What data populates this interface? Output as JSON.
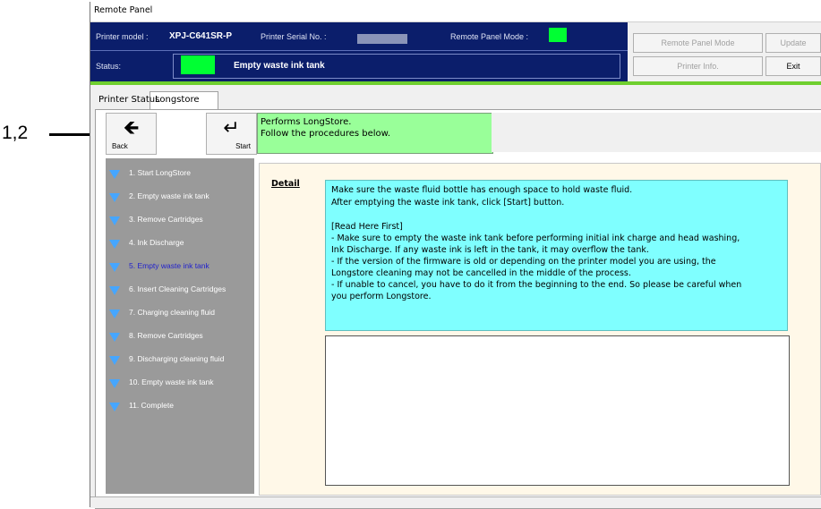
{
  "callout": {
    "label": "1,2"
  },
  "window": {
    "title": "Remote Panel"
  },
  "header": {
    "printer_model_label": "Printer model :",
    "printer_model_value": "XPJ-C641SR-P",
    "serial_label": "Printer Serial No. :",
    "remote_mode_label": "Remote Panel Mode :",
    "status_label": "Status:",
    "status_value": "Empty waste ink tank",
    "indicator_color": "#00ff33"
  },
  "side_buttons": {
    "remote_panel_mode": "Remote Panel Mode",
    "update": "Update",
    "printer_info": "Printer Info.",
    "exit": "Exit"
  },
  "tabs": [
    {
      "label": "Printer Status",
      "active": false
    },
    {
      "label": "Longstore",
      "active": true
    }
  ],
  "toolbar": {
    "back_label": "Back",
    "start_label": "Start",
    "back_icon": "arrow-left-icon",
    "start_icon": "return-arrow-icon"
  },
  "message": {
    "line1": "Performs LongStore.",
    "line2": "Follow the procedures below."
  },
  "steps": [
    {
      "label": "1. Start LongStore"
    },
    {
      "label": "2. Empty waste ink tank"
    },
    {
      "label": "3. Remove Cartridges"
    },
    {
      "label": "4. Ink Discharge"
    },
    {
      "label": "5. Empty waste ink tank",
      "current": true
    },
    {
      "label": "6. Insert Cleaning Cartridges"
    },
    {
      "label": "7. Charging cleaning fluid"
    },
    {
      "label": "8. Remove Cartridges"
    },
    {
      "label": "9. Discharging cleaning fluid"
    },
    {
      "label": "10. Empty waste ink tank"
    },
    {
      "label": "11. Complete"
    }
  ],
  "detail": {
    "label": "Detail",
    "lines": [
      "Make sure the waste fluid bottle has enough space to hold waste fluid.",
      "After emptying the waste ink tank, click [Start] button.",
      "",
      "[Read Here First]",
      "- Make sure to empty the waste ink tank before performing initial ink charge and head washing,",
      "Ink Discharge. If any waste ink is left in the tank, it may overflow the tank.",
      " - If the version of the firmware is old or depending on the printer model you are using, the",
      "Longstore cleaning may not be cancelled in the middle of the process.",
      " - If unable to cancel, you have to do it from the beginning to the end. So please be careful when",
      "you perform Longstore."
    ]
  },
  "colors": {
    "header_bg": "#0b1e6b",
    "accent_green": "#6fcf2f",
    "message_bg": "#99ff99",
    "detail_bg": "#7fffff",
    "steps_bg": "#9a9a9a",
    "step_icon": "#46a6ff"
  }
}
